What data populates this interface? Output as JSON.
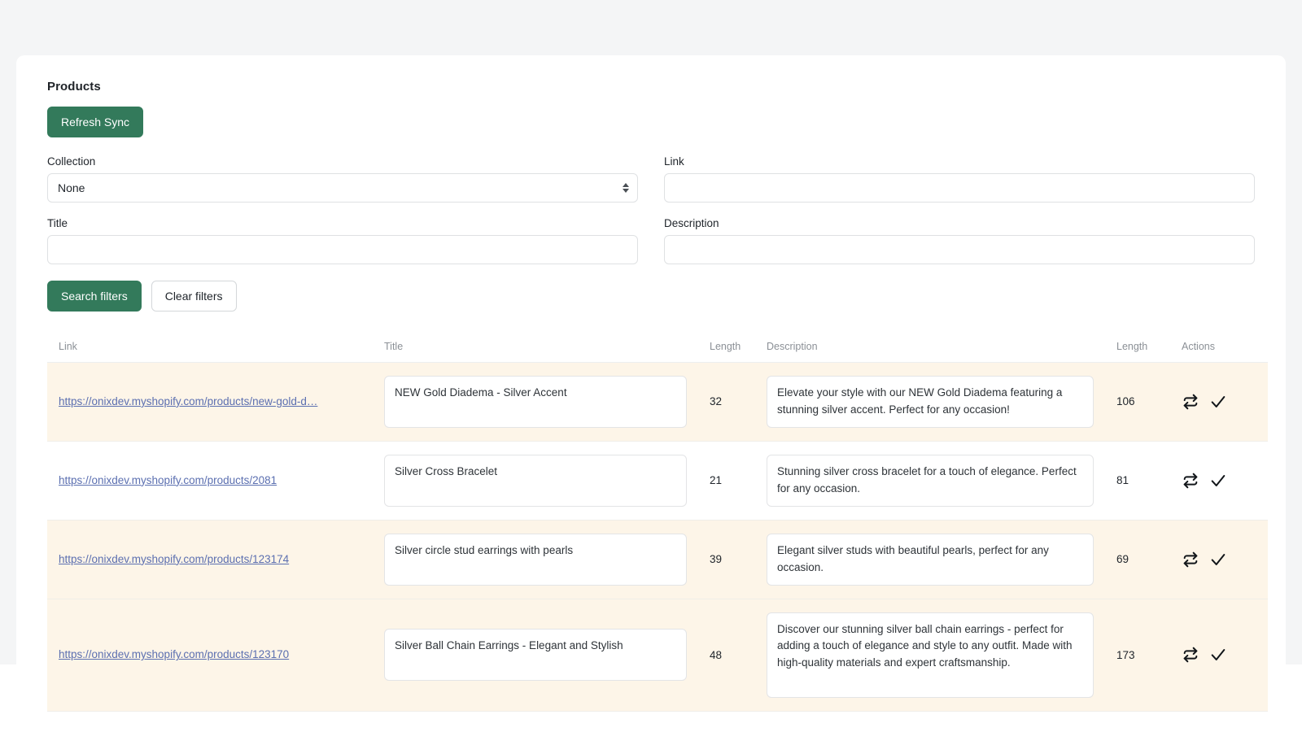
{
  "page": {
    "title": "Products",
    "background_color": "#f4f5f6",
    "accent_color": "#337a5b"
  },
  "toolbar": {
    "refresh_sync_label": "Refresh Sync"
  },
  "filters": {
    "collection": {
      "label": "Collection",
      "value": "None",
      "options": [
        "None"
      ]
    },
    "link": {
      "label": "Link",
      "value": "",
      "placeholder": ""
    },
    "title": {
      "label": "Title",
      "value": "",
      "placeholder": ""
    },
    "description": {
      "label": "Description",
      "value": "",
      "placeholder": ""
    },
    "search_button_label": "Search filters",
    "clear_button_label": "Clear filters"
  },
  "table": {
    "headers": {
      "link": "Link",
      "title": "Title",
      "title_length": "Length",
      "description": "Description",
      "description_length": "Length",
      "actions": "Actions"
    },
    "rows": [
      {
        "link": "https://onixdev.myshopify.com/products/new-gold-d…",
        "title": "NEW Gold Diadema - Silver Accent",
        "title_length": "32",
        "description": "Elevate your style with our NEW Gold Diadema featuring a stunning silver accent. Perfect for any occasion!",
        "description_length": "106",
        "tinted": true
      },
      {
        "link": "https://onixdev.myshopify.com/products/2081",
        "title": "Silver Cross Bracelet",
        "title_length": "21",
        "description": "Stunning silver cross bracelet for a touch of elegance. Perfect for any occasion.",
        "description_length": "81",
        "tinted": false
      },
      {
        "link": "https://onixdev.myshopify.com/products/123174",
        "title": "Silver circle stud earrings with pearls",
        "title_length": "39",
        "description": "Elegant silver studs with beautiful pearls, perfect for any occasion.",
        "description_length": "69",
        "tinted": true
      },
      {
        "link": "https://onixdev.myshopify.com/products/123170",
        "title": "Silver Ball Chain Earrings - Elegant and Stylish",
        "title_length": "48",
        "description": "Discover our stunning silver ball chain earrings - perfect for adding a touch of elegance and style to any outfit. Made with high-quality materials and expert craftsmanship.",
        "description_length": "173",
        "tinted": true
      }
    ],
    "action_icons": [
      "sync-icon",
      "check-icon"
    ]
  }
}
